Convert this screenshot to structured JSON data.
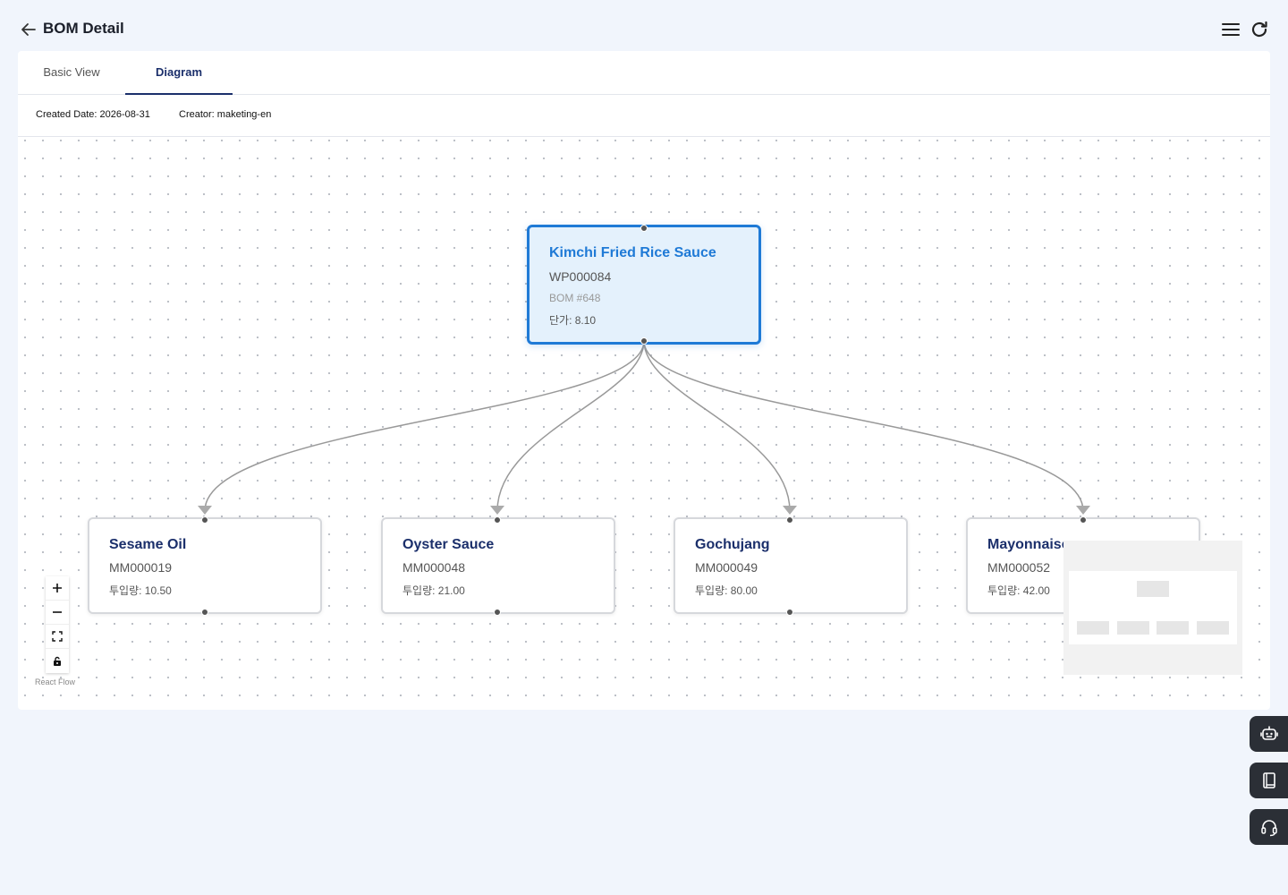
{
  "header": {
    "title": "BOM Detail"
  },
  "tabs": [
    {
      "label": "Basic View",
      "active": false
    },
    {
      "label": "Diagram",
      "active": true
    }
  ],
  "meta": {
    "created_date": "Created Date: 2026-08-31",
    "creator": "Creator: maketing-en"
  },
  "diagram": {
    "root": {
      "name": "Kimchi Fried Rice Sauce",
      "code": "WP000084",
      "bom": "BOM #648",
      "price": "단가: 8.10"
    },
    "children": [
      {
        "name": "Sesame Oil",
        "code": "MM000019",
        "qty": "투입량: 10.50"
      },
      {
        "name": "Oyster Sauce",
        "code": "MM000048",
        "qty": "투입량: 21.00"
      },
      {
        "name": "Gochujang",
        "code": "MM000049",
        "qty": "투입량: 80.00"
      },
      {
        "name": "Mayonnaise",
        "code": "MM000052",
        "qty": "투입량: 42.00"
      }
    ],
    "attribution": "React Flow"
  },
  "icons": {
    "back": "arrow-left-icon",
    "menu": "hamburger-menu-icon",
    "refresh": "refresh-icon",
    "zoom_in": "plus-icon",
    "zoom_out": "minus-icon",
    "fit_view": "fit-view-icon",
    "lock": "lock-icon",
    "chatbot": "robot-icon",
    "manual": "book-icon",
    "support": "headset-icon"
  },
  "colors": {
    "accent": "#1f7ad6",
    "title": "#1b2f6b",
    "root_bg": "#e4f1fc"
  }
}
